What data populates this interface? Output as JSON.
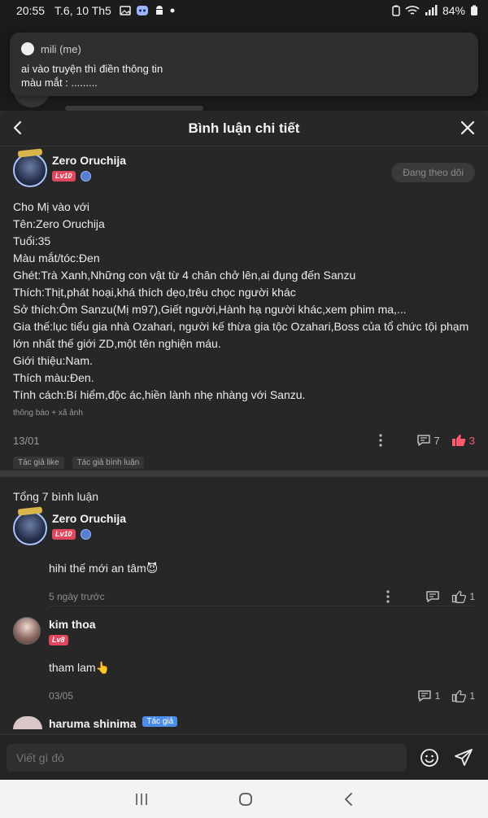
{
  "status": {
    "time": "20:55",
    "date": "T.6, 10 Th5",
    "battery": "84%"
  },
  "toast": {
    "sender": "mili (me)",
    "line1": "ai vào truyện thì điền thông tin",
    "line2": "màu mắt : ........."
  },
  "header": {
    "title": "Bình luận chi tiết"
  },
  "post": {
    "author": "Zero Oruchija",
    "level": "Lv10",
    "follow_label": "Đang theo dõi",
    "lines": [
      "Cho Mị vào với",
      "Tên:Zero Oruchija",
      "Tuổi:35",
      "Màu mắt/tóc:Đen",
      "Ghét:Trà Xanh,Những con vật từ 4 chân chở lên,ai đụng đến Sanzu",
      "Thích:Thịt,phát hoại,khá thích dẹo,trêu chọc người khác",
      "Sở thích:Ôm Sanzu(Mị m97),Giết người,Hành hạ người khác,xem phim ma,...",
      "Gia thế:lục tiểu gia nhà Ozahari, người kế thừa gia tộc Ozahari,Boss của tổ chức tội phạm lớn nhất thế giới ZD,một tên nghiện máu.",
      "Giới thiệu:Nam.",
      "Thích màu:Đen.",
      "Tính cách:Bí hiểm,độc ác,hiền lành nhẹ nhàng với Sanzu."
    ],
    "note": "thông báo + xã ảnh",
    "date": "13/01",
    "comment_count": "7",
    "like_count": "3",
    "tag1": "Tác giả like",
    "tag2": "Tác giả bình luận"
  },
  "total_label": "Tổng 7 bình luận",
  "comments": [
    {
      "author": "Zero Oruchija",
      "level": "Lv10",
      "text": "hihi thế mới an tâm😈",
      "time": "5 ngày trước",
      "likes": "1"
    },
    {
      "author": "kim thoa",
      "level": "Lv8",
      "text": "tham lam👆",
      "time": "03/05",
      "replies": "1",
      "likes": "1"
    },
    {
      "author": "haruma shinima",
      "tag": "Tác giả"
    }
  ],
  "input": {
    "placeholder": "Viết gì đó"
  },
  "colors": {
    "like": "#ff5a6e",
    "level_badge": "#e0485f",
    "author_tag": "#4a8ee8"
  }
}
